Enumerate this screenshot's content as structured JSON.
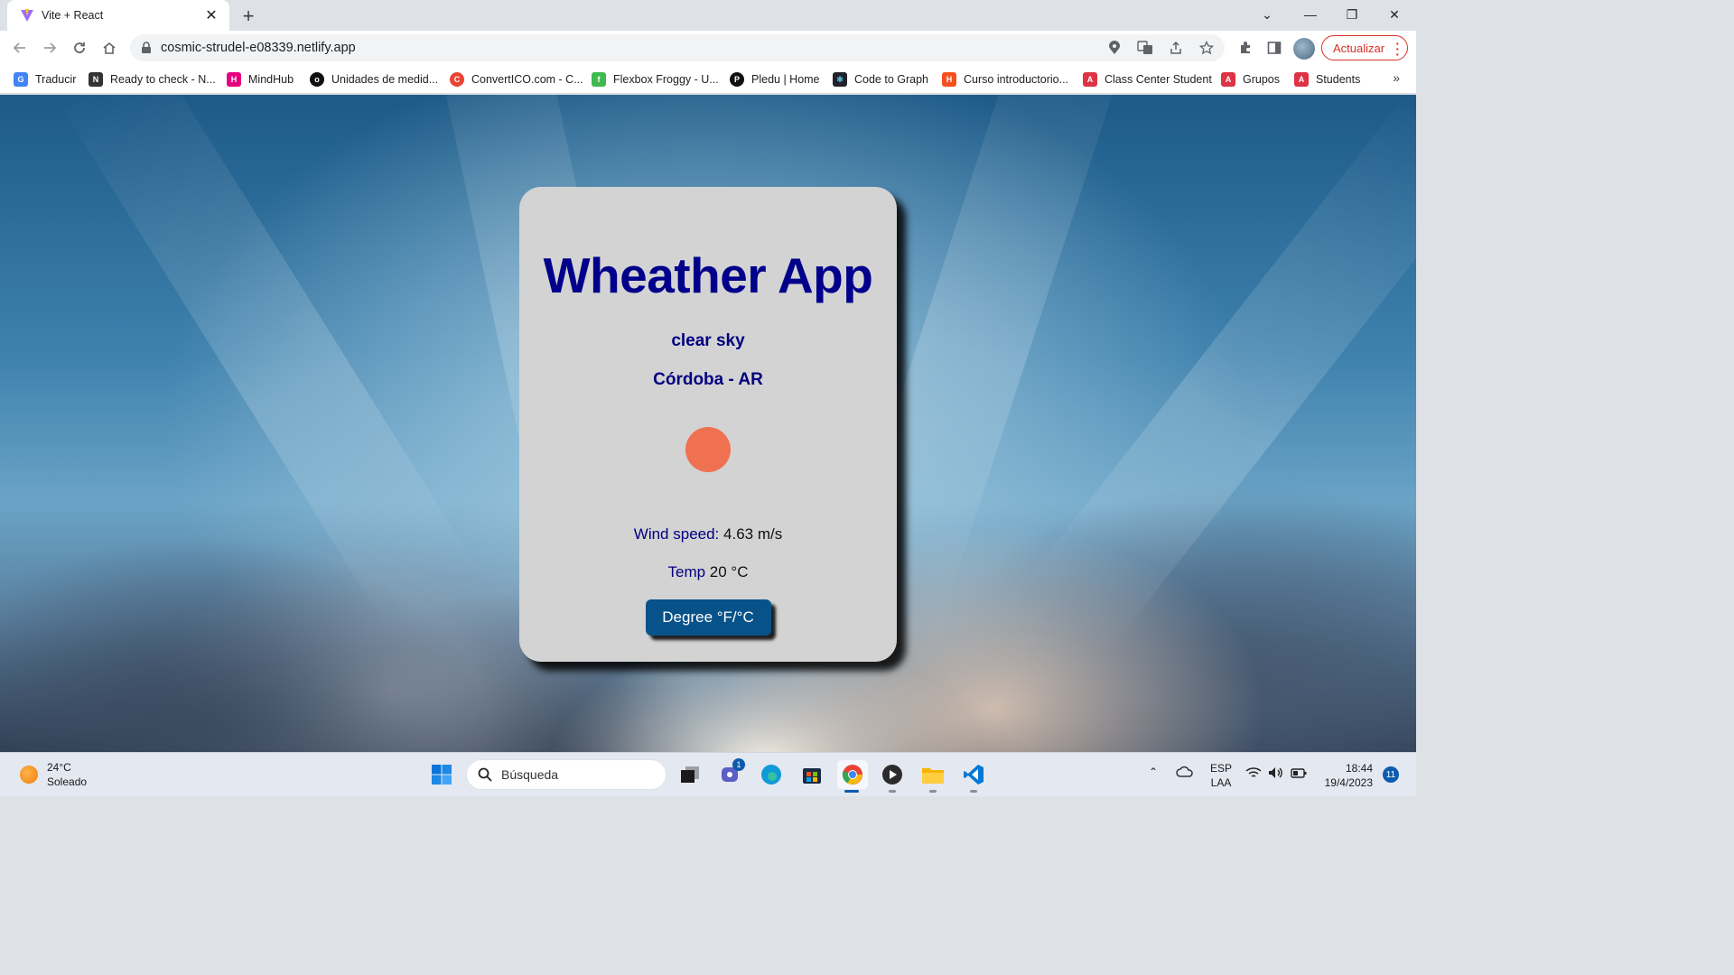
{
  "browser": {
    "tab_title": "Vite + React",
    "url": "cosmic-strudel-e08339.netlify.app",
    "update_label": "Actualizar",
    "bookmarks": [
      {
        "label": "Traducir",
        "icon": "google-translate-icon",
        "color": "#4285f4"
      },
      {
        "label": "Ready to check - N...",
        "icon": "notion-icon",
        "color": "#333333"
      },
      {
        "label": "MindHub",
        "icon": "mindhub-icon",
        "color": "#e6007e"
      },
      {
        "label": "Unidades de medid...",
        "icon": "link-icon",
        "color": "#111111"
      },
      {
        "label": "ConvertICO.com - C...",
        "icon": "converter-icon",
        "color": "#ea4335"
      },
      {
        "label": "Flexbox Froggy - U...",
        "icon": "frog-icon",
        "color": "#3fb950"
      },
      {
        "label": "Pledu | Home",
        "icon": "pledu-icon",
        "color": "#111111"
      },
      {
        "label": "Code to Graph",
        "icon": "react-icon",
        "color": "#20232a"
      },
      {
        "label": "Curso introductorio...",
        "icon": "html-icon",
        "color": "#f4511e"
      },
      {
        "label": "Class Center Student",
        "icon": "angular-icon",
        "color": "#dd3344"
      },
      {
        "label": "Grupos",
        "icon": "angular-icon",
        "color": "#dd3344"
      },
      {
        "label": "Students",
        "icon": "angular-icon",
        "color": "#dd3344"
      }
    ]
  },
  "app": {
    "title": "Wheather App",
    "description": "clear sky",
    "location": "Córdoba - AR",
    "weather_icon": "sun-icon",
    "icon_color": "#ef7150",
    "wind_label": "Wind speed:",
    "wind_value": "4.63 m/s",
    "temp_label": "Temp",
    "temp_value": "20 °C",
    "degree_button": "Degree °F/°C"
  },
  "taskbar": {
    "weather_temp": "24°C",
    "weather_desc": "Soleado",
    "search_placeholder": "Búsqueda",
    "lang_top": "ESP",
    "lang_bottom": "LAA",
    "time": "18:44",
    "date": "19/4/2023",
    "notifications": "11",
    "teams_badge": "1"
  }
}
